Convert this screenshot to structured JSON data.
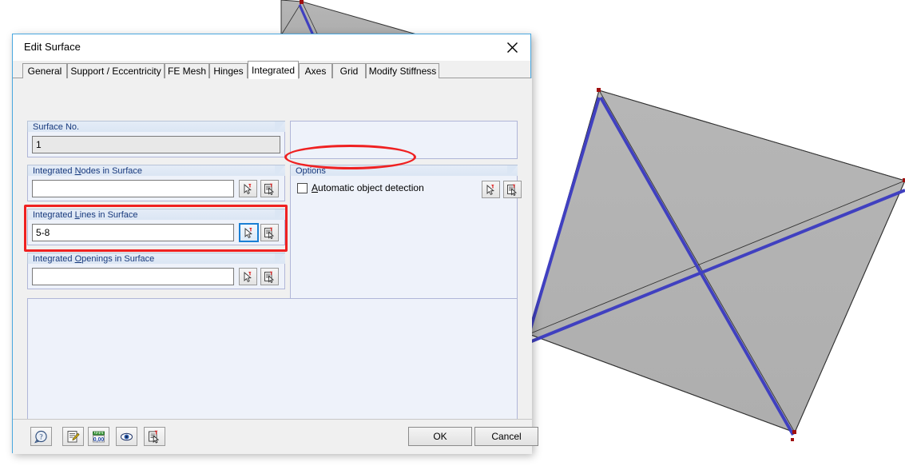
{
  "window": {
    "title": "Edit Surface",
    "close_icon": "close-icon"
  },
  "tabs": [
    {
      "label": "General",
      "active": false
    },
    {
      "label": "Support / Eccentricity",
      "active": false
    },
    {
      "label": "FE Mesh",
      "active": false
    },
    {
      "label": "Hinges",
      "active": false
    },
    {
      "label": "Integrated",
      "active": true
    },
    {
      "label": "Axes",
      "active": false
    },
    {
      "label": "Grid",
      "active": false
    },
    {
      "label": "Modify Stiffness",
      "active": false
    }
  ],
  "left_panel": {
    "surface_no": {
      "group_label": "Surface No.",
      "value": "1"
    },
    "integrated_nodes": {
      "group_label_pre": "Integrated ",
      "group_label_key": "N",
      "group_label_post": "odes in Surface",
      "value": "",
      "pick_icon": "pick-single-icon",
      "list_icon": "pick-list-icon"
    },
    "integrated_lines": {
      "group_label_pre": "Integrated ",
      "group_label_key": "L",
      "group_label_post": "ines in Surface",
      "value": "5-8",
      "pick_icon": "pick-single-icon",
      "list_icon": "pick-list-icon",
      "highlighted": true
    },
    "integrated_openings": {
      "group_label_pre": "Integrated ",
      "group_label_key": "O",
      "group_label_post": "penings in Surface",
      "value": "",
      "pick_icon": "pick-single-icon",
      "list_icon": "pick-list-icon"
    }
  },
  "right_panel": {
    "options": {
      "group_label": "Options",
      "checkbox": {
        "label_pre": "",
        "label_key": "A",
        "label_post": "utomatic object detection",
        "checked": false
      },
      "pick_icon": "pick-single-icon",
      "list_icon": "pick-list-icon",
      "highlighted": true
    }
  },
  "footer": {
    "tool_buttons": [
      {
        "name": "help-icon",
        "title": "Help"
      },
      {
        "name": "edit-icon",
        "title": "Edit"
      },
      {
        "name": "units-icon",
        "title": "Units and Decimal Places"
      },
      {
        "name": "eye-icon",
        "title": "View Mode"
      },
      {
        "name": "pick-list-icon",
        "title": "Select Objects"
      }
    ],
    "ok_label": "OK",
    "cancel_label": "Cancel"
  },
  "colors": {
    "accent_border": "#4aa8e0",
    "highlight_red": "#ef2121",
    "group_title_blue": "#16387c",
    "group_body_bg": "#eef2fa",
    "surface_fill": "#b3b3b3",
    "line_blue": "#4040c0",
    "node_red": "#a01010"
  },
  "model": {
    "description": "3D shaded surface with integrated diagonal lines",
    "surface_fill": "#b3b3b3",
    "edge_color": "#333333",
    "integrated_line_color": "#4040c0",
    "node_marker_color": "#a01010"
  }
}
